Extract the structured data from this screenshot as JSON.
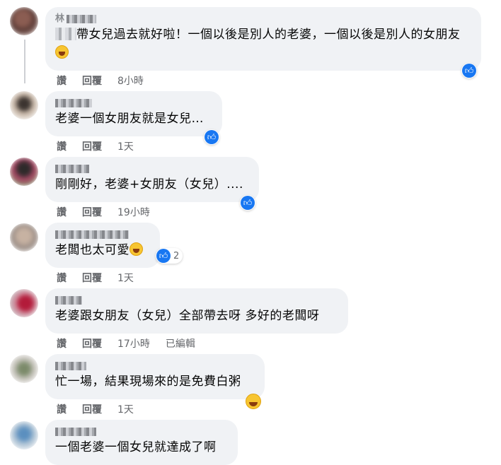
{
  "actions": {
    "like": "讚",
    "reply": "回覆"
  },
  "comments": [
    {
      "author": "林",
      "redacted_prefix": true,
      "text": "帶女兒過去就好啦！一個以後是別人的老婆，一個以後是別人的女朋友",
      "emoji": "rolling-laughing-emoji",
      "time": "8小時",
      "edited": "",
      "reaction_count": ""
    },
    {
      "author": "",
      "redacted_prefix": false,
      "text": "老婆一個女朋友就是女兒…",
      "emoji": "",
      "time": "1天",
      "edited": "",
      "reaction_count": ""
    },
    {
      "author": "",
      "redacted_prefix": false,
      "text": "剛剛好，老婆+女朋友（女兒）....",
      "emoji": "",
      "time": "19小時",
      "edited": "",
      "reaction_count": ""
    },
    {
      "author": "",
      "redacted_prefix": false,
      "text": "老闆也太可愛",
      "emoji": "grinning-emoji",
      "time": "1天",
      "edited": "",
      "reaction_count": "2"
    },
    {
      "author": "",
      "redacted_prefix": false,
      "text": "老婆跟女朋友（女兒）全部帶去呀 多好的老闆呀",
      "emoji": "",
      "time": "17小時",
      "edited": "已編輯",
      "reaction_count": ""
    },
    {
      "author": "",
      "redacted_prefix": false,
      "text": "忙一場，結果現場來的是免費白粥",
      "emoji": "squinting-laugh-emoji",
      "time": "1天",
      "edited": "",
      "reaction_count": ""
    },
    {
      "author": "",
      "redacted_prefix": false,
      "text": "一個老婆一個女兒就達成了啊",
      "emoji": "",
      "time": "",
      "edited": "",
      "reaction_count": ""
    }
  ],
  "colors": {
    "bubble": "#f0f2f5",
    "like_blue": "#1877f2",
    "meta_gray": "#65676b"
  }
}
